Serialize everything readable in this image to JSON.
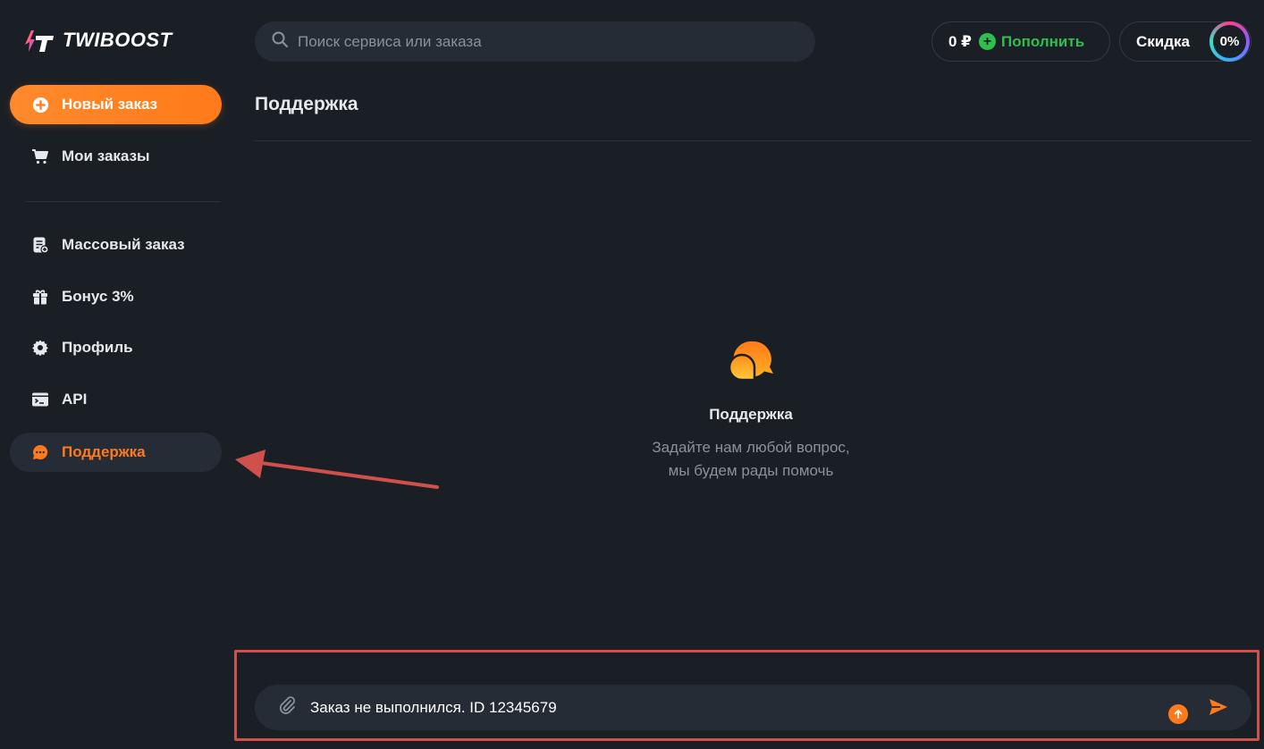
{
  "brand": {
    "name": "TWIBOOST"
  },
  "sidebar": {
    "items": [
      {
        "label": "Новый заказ",
        "icon": "plus-circle-icon"
      },
      {
        "label": "Мои заказы",
        "icon": "cart-icon"
      },
      {
        "label": "Массовый заказ",
        "icon": "bulk-order-icon"
      },
      {
        "label": "Бонус 3%",
        "icon": "gift-icon"
      },
      {
        "label": "Профиль",
        "icon": "gear-icon"
      },
      {
        "label": "API",
        "icon": "terminal-icon"
      },
      {
        "label": "Поддержка",
        "icon": "chat-bubble-icon"
      }
    ]
  },
  "header": {
    "search_placeholder": "Поиск сервиса или заказа",
    "balance": "0 ₽",
    "topup_label": "Пополнить",
    "discount_label": "Скидка",
    "discount_value": "0%"
  },
  "page": {
    "title": "Поддержка",
    "empty_title": "Поддержка",
    "empty_line1": "Задайте нам любой вопрос,",
    "empty_line2": "мы будем рады помочь"
  },
  "composer": {
    "message_value": "Заказ не выполнился. ID 12345679"
  },
  "colors": {
    "accent": "#ff7a1a",
    "green": "#2fbf4e",
    "background": "#1a1f26",
    "annotation": "#d0514c"
  }
}
